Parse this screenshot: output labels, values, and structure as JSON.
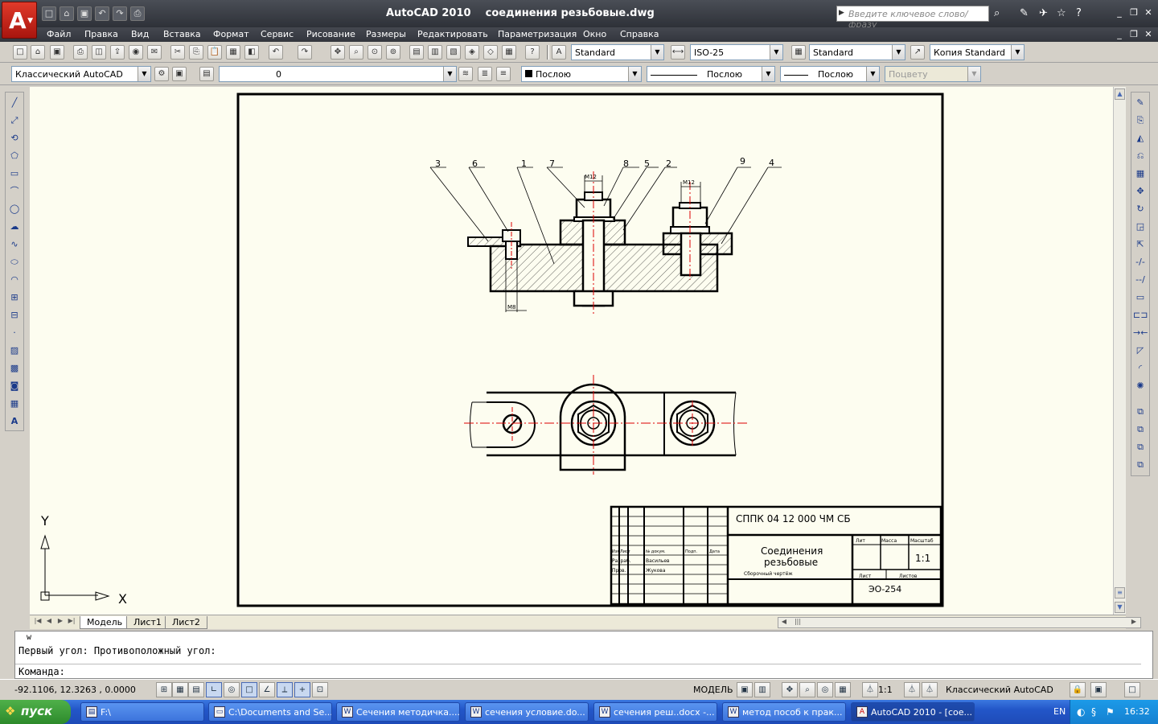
{
  "window": {
    "app_name": "AutoCAD 2010",
    "document": "соединения резьбовые.dwg",
    "search_placeholder": "Введите ключевое слово/фразу"
  },
  "menu": [
    "Файл",
    "Правка",
    "Вид",
    "Вставка",
    "Формат",
    "Сервис",
    "Рисование",
    "Размеры",
    "Редактировать",
    "Параметризация",
    "Окно",
    "Справка"
  ],
  "toolbar": {
    "text_style": "Standard",
    "dim_style": "ISO-25",
    "table_style": "Standard",
    "multileader_style": "Копия Standard",
    "workspace": "Классический AutoCAD",
    "layer": "0",
    "color": "Послою",
    "linetype": "Послою",
    "lineweight": "Послою",
    "plotstyle": "Поцвету"
  },
  "drawing": {
    "ucs_x": "X",
    "ucs_y": "Y",
    "leaders": [
      "3",
      "6",
      "1",
      "7",
      "8",
      "5",
      "2",
      "9",
      "4"
    ],
    "dim_m12": "M12",
    "dim_m12_right": "M12",
    "dim_m8": "M8",
    "title_block": {
      "code": "СППК 04 12 000 ЧМ СБ",
      "name_line1": "Соединения",
      "name_line2": "резьбовые",
      "doc_type": "Сборочный чертёж",
      "scale": "1:1",
      "group": "ЭО-254",
      "col_lit": "Лит",
      "col_mass": "Масса",
      "col_scale": "Масштаб",
      "sheet": "Лист",
      "sheets": "Листов",
      "row_izm": "Изм",
      "row_list": "Лист",
      "row_doc": "№ докум.",
      "row_sign": "Подп.",
      "row_date": "Дата",
      "row_dev": "Разраб.",
      "row_check": "Пров.",
      "dev_name": "Васильев",
      "check_name": "Жукова"
    }
  },
  "tabs": [
    "Модель",
    "Лист1",
    "Лист2"
  ],
  "command": {
    "history1": "w",
    "history2": "Первый угол: Противоположный угол:",
    "prompt": "Команда:"
  },
  "status": {
    "coords": "-92.1106, 12.3263 , 0.0000",
    "model": "МОДЕЛЬ",
    "scale": "1:1",
    "workspace": "Классический AutoCAD"
  },
  "taskbar": {
    "start": "пуск",
    "tasks": [
      "F:\\",
      "C:\\Documents and Se...",
      "Сечения методичка....",
      "сечения условие.do...",
      "сечения реш..docx -...",
      "метод пособ к прак...",
      "AutoCAD 2010 - [сое..."
    ],
    "lang": "EN",
    "clock": "16:32"
  }
}
